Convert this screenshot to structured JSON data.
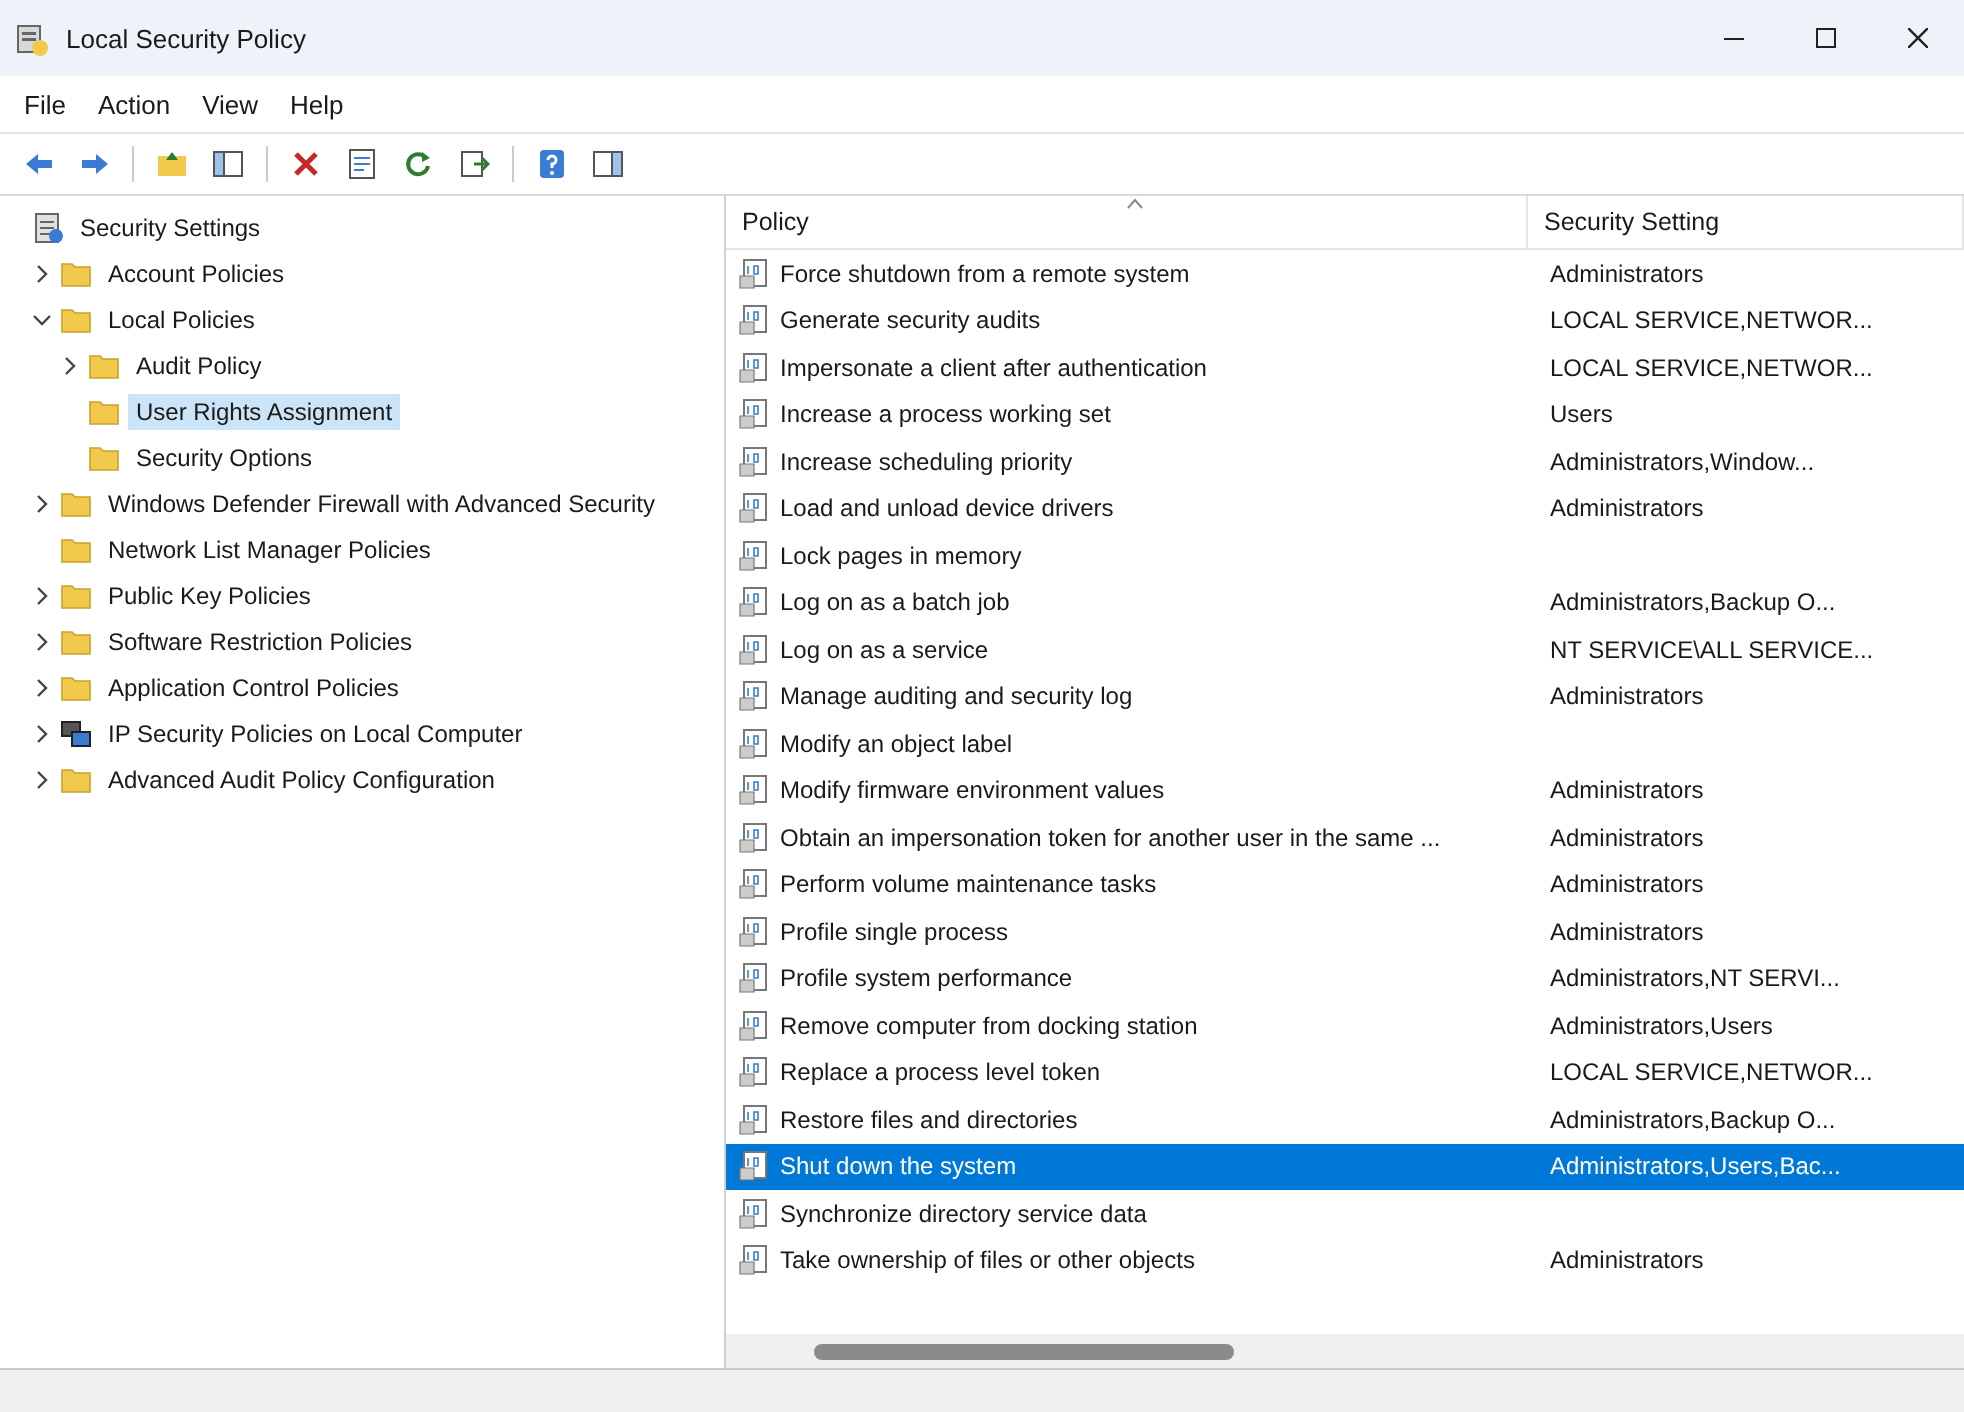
{
  "window": {
    "title": "Local Security Policy"
  },
  "menu": [
    {
      "label": "File"
    },
    {
      "label": "Action"
    },
    {
      "label": "View"
    },
    {
      "label": "Help"
    }
  ],
  "tree": [
    {
      "label": "Security Settings",
      "kind": "settings",
      "selected": false,
      "children": [
        {
          "label": "Account Policies",
          "kind": "folder",
          "expanded": false,
          "selected": false
        },
        {
          "label": "Local Policies",
          "kind": "folder",
          "expanded": true,
          "selected": false,
          "children": [
            {
              "label": "Audit Policy",
              "kind": "folder",
              "expanded": false,
              "selected": false
            },
            {
              "label": "User Rights Assignment",
              "kind": "folder",
              "selected": true
            },
            {
              "label": "Security Options",
              "kind": "folder",
              "selected": false
            }
          ]
        },
        {
          "label": "Windows Defender Firewall with Advanced Security",
          "kind": "folder",
          "expanded": false,
          "selected": false
        },
        {
          "label": "Network List Manager Policies",
          "kind": "folder",
          "selected": false
        },
        {
          "label": "Public Key Policies",
          "kind": "folder",
          "expanded": false,
          "selected": false
        },
        {
          "label": "Software Restriction Policies",
          "kind": "folder",
          "expanded": false,
          "selected": false
        },
        {
          "label": "Application Control Policies",
          "kind": "folder",
          "expanded": false,
          "selected": false
        },
        {
          "label": "IP Security Policies on Local Computer",
          "kind": "network",
          "expanded": false,
          "selected": false
        },
        {
          "label": "Advanced Audit Policy Configuration",
          "kind": "folder",
          "expanded": false,
          "selected": false
        }
      ]
    }
  ],
  "table": {
    "columns": [
      "Policy",
      "Security Setting"
    ],
    "rows": [
      {
        "policy": "Force shutdown from a remote system",
        "setting": "Administrators",
        "selected": false
      },
      {
        "policy": "Generate security audits",
        "setting": "LOCAL SERVICE,NETWOR...",
        "selected": false
      },
      {
        "policy": "Impersonate a client after authentication",
        "setting": "LOCAL SERVICE,NETWOR...",
        "selected": false
      },
      {
        "policy": "Increase a process working set",
        "setting": "Users",
        "selected": false
      },
      {
        "policy": "Increase scheduling priority",
        "setting": "Administrators,Window...",
        "selected": false
      },
      {
        "policy": "Load and unload device drivers",
        "setting": "Administrators",
        "selected": false
      },
      {
        "policy": "Lock pages in memory",
        "selected": false
      },
      {
        "policy": "Log on as a batch job",
        "setting": "Administrators,Backup O...",
        "selected": false
      },
      {
        "policy": "Log on as a service",
        "setting": "NT SERVICE\\ALL SERVICE...",
        "selected": false
      },
      {
        "policy": "Manage auditing and security log",
        "setting": "Administrators",
        "selected": false
      },
      {
        "policy": "Modify an object label",
        "selected": false
      },
      {
        "policy": "Modify firmware environment values",
        "setting": "Administrators",
        "selected": false
      },
      {
        "policy": "Obtain an impersonation token for another user in the same ...",
        "setting": "Administrators",
        "selected": false
      },
      {
        "policy": "Perform volume maintenance tasks",
        "setting": "Administrators",
        "selected": false
      },
      {
        "policy": "Profile single process",
        "setting": "Administrators",
        "selected": false
      },
      {
        "policy": "Profile system performance",
        "setting": "Administrators,NT SERVI...",
        "selected": false
      },
      {
        "policy": "Remove computer from docking station",
        "setting": "Administrators,Users",
        "selected": false
      },
      {
        "policy": "Replace a process level token",
        "setting": "LOCAL SERVICE,NETWOR...",
        "selected": false
      },
      {
        "policy": "Restore files and directories",
        "setting": "Administrators,Backup O...",
        "selected": false
      },
      {
        "policy": "Shut down the system",
        "setting": "Administrators,Users,Bac...",
        "selected": true
      },
      {
        "policy": "Synchronize directory service data",
        "selected": false
      },
      {
        "policy": "Take ownership of files or other objects",
        "setting": "Administrators",
        "selected": false
      }
    ]
  }
}
